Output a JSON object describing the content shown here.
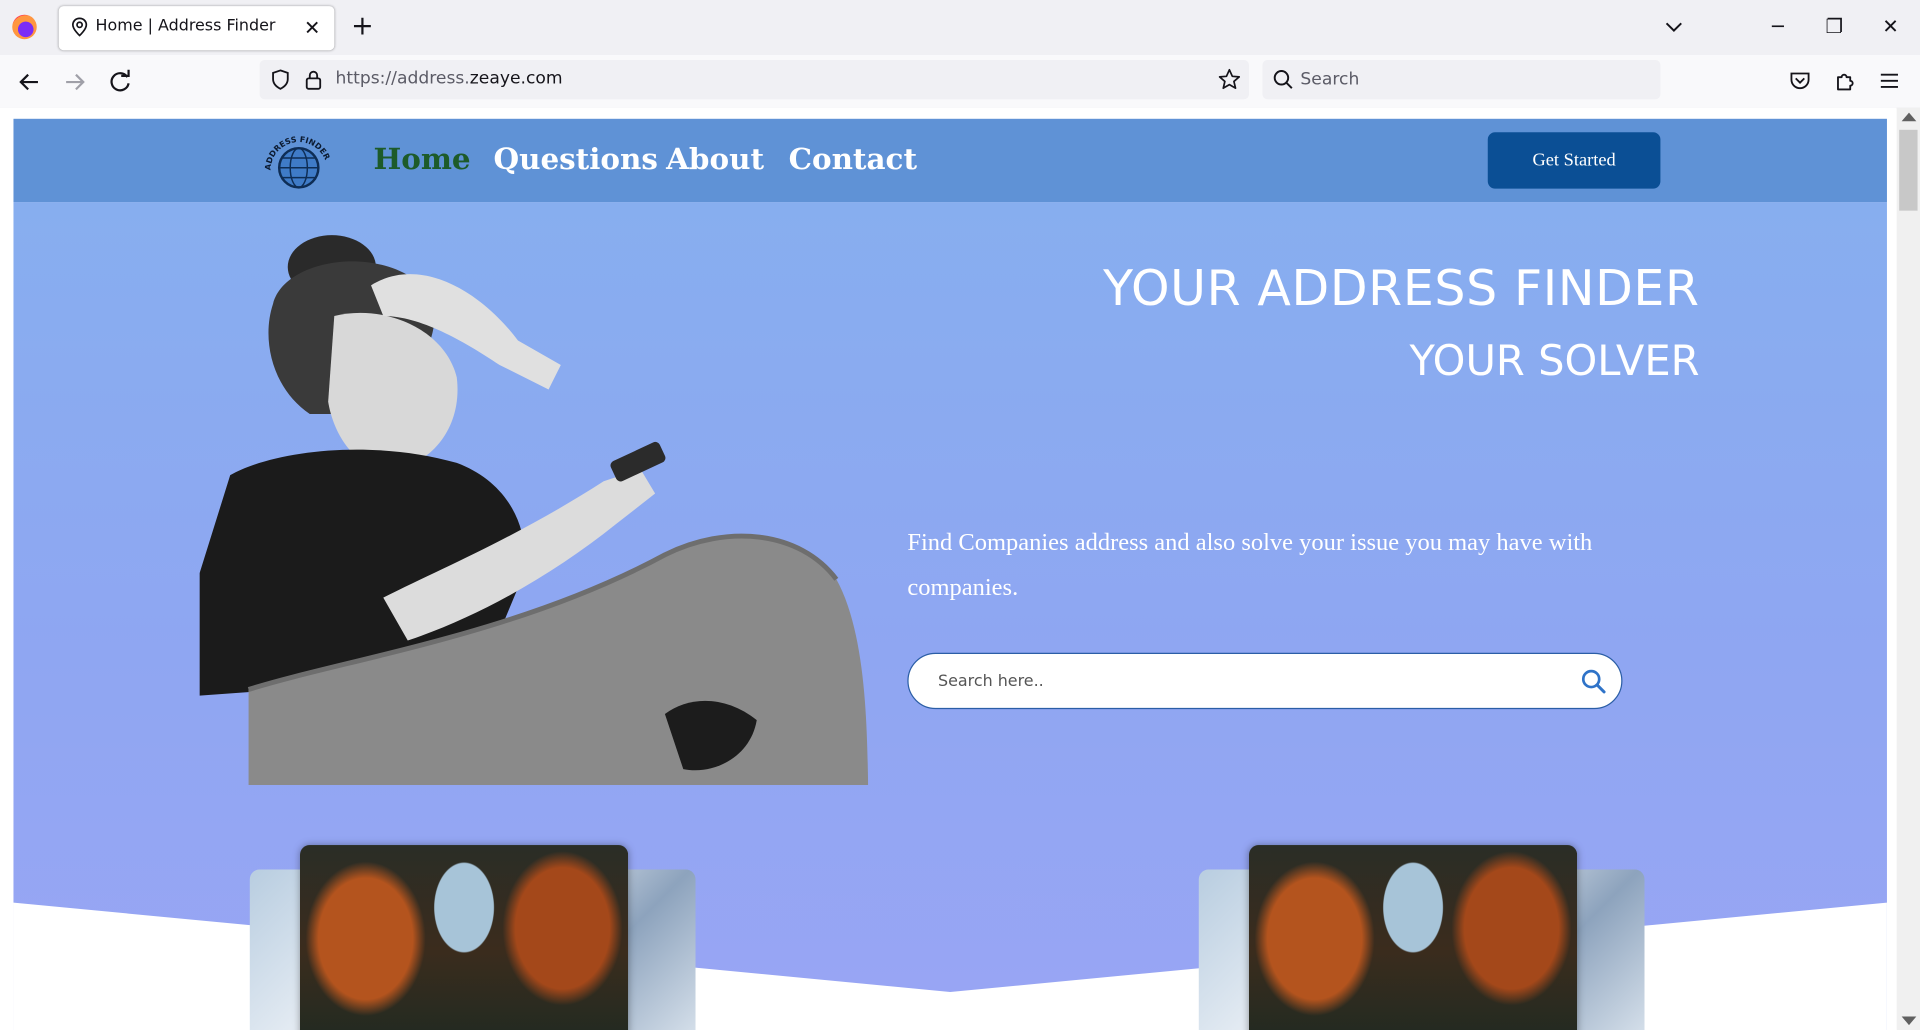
{
  "browser": {
    "tab_title": "Home | Address Finder",
    "url_prefix": "https://address.",
    "url_domain": "zeaye.com",
    "search_placeholder": "Search"
  },
  "site": {
    "nav": [
      "Home",
      "Questions",
      "About",
      "Contact"
    ],
    "active_nav": "Home",
    "cta_label": "Get Started",
    "hero_title": "YOUR ADDRESS FINDER",
    "hero_subtitle": "YOUR SOLVER",
    "hero_description": "Find Companies address and also solve your issue you may have with companies.",
    "search_placeholder": "Search here..",
    "logo_text": "ADDRESS FINDER"
  },
  "colors": {
    "header_bg": "#5f92d6",
    "active_nav": "#1d5b2a",
    "cta_bg": "#0b4f95",
    "hero_top": "#87aeef",
    "hero_bottom": "#99a5f4"
  }
}
